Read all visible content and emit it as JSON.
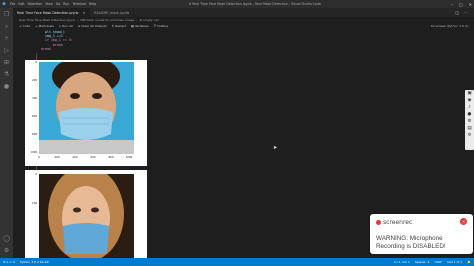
{
  "window": {
    "title": "8 Real Time Face Mask Detection.ipynb - Face Mask Detection - Visual Studio Code",
    "menu": [
      "File",
      "Edit",
      "Selection",
      "View",
      "Go",
      "Run",
      "Terminal",
      "Help"
    ]
  },
  "tabs": [
    {
      "label": "Real Time Face Mask Detection.ipynb",
      "active": true
    },
    {
      "label": "README_mask.ipynb",
      "active": false
    }
  ],
  "breadcrumb": [
    "Real Time Face Mask Detection.ipynb",
    "M#check model for unknown image",
    "# empty cell"
  ],
  "toolbar": {
    "items": [
      "Code",
      "Markdown",
      "Run All",
      "Clear All Outputs",
      "Restart",
      "Variables",
      "Outline"
    ],
    "kernel": "Facemask (Python 3.6.4)"
  },
  "code": {
    "line1": "plt.show()",
    "line2": "img_1 +=1",
    "line3": "if img_1 >= 3:",
    "line4": "break",
    "line5": "break"
  },
  "cells": {
    "exec_count_1": "[20]",
    "exec_count_2": "[21]"
  },
  "figure1": {
    "yticks": [
      "0",
      "200",
      "400",
      "600",
      "800",
      "1000"
    ],
    "xticks": [
      "0",
      "200",
      "400",
      "600",
      "800",
      "1000"
    ]
  },
  "figure2": {
    "yticks": [
      "0",
      "100"
    ]
  },
  "toast": {
    "brand": "screenrec",
    "message": "WARNING: Microphone Recording is DISABLED!"
  },
  "statusbar": {
    "left": [
      "⊗ 0 ⚠ 0",
      "Python 3.6.4 64-bit"
    ],
    "right": [
      "Ln 1, Col 1",
      "Spaces: 4",
      "CRLF",
      "Cell 1 of 1"
    ]
  },
  "colors": {
    "statusbar": "#007acc",
    "photo1_bg": "#3aa8d4",
    "mask": "#8ecae6",
    "toast_red": "#e53935"
  }
}
